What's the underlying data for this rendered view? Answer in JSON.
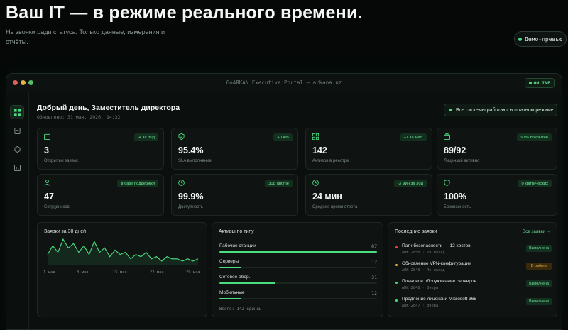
{
  "hero": {
    "title": "Ваш IT — в режиме реального времени.",
    "subtitle": "Не звонки ради статуса. Только данные, измерения и отчёты.",
    "demo_button": "Демо-превью"
  },
  "window": {
    "title": "GoARKAN Executive Portal — arkana.uz",
    "status": "ONLINE"
  },
  "sidebar": {
    "items": [
      {
        "icon": "grid-icon",
        "active": true
      },
      {
        "icon": "document-icon",
        "active": false
      },
      {
        "icon": "hexagon-icon",
        "active": false
      },
      {
        "icon": "chart-icon",
        "active": false
      }
    ]
  },
  "header": {
    "greeting": "Добрый день, Заместитель директора",
    "updated": "Обновлено: 31 мая. 2026, 14:32",
    "system_status": "Все системы работают в штатном режиме"
  },
  "kpis": [
    {
      "icon": "calendar-icon",
      "badge": "-4 за 30д",
      "value": "3",
      "label": "Открытых заявок"
    },
    {
      "icon": "shield-check-icon",
      "badge": "+0.4%",
      "value": "95.4%",
      "label": "SLA выполнение"
    },
    {
      "icon": "grid-icon",
      "badge": "+1 за мес.",
      "value": "142",
      "label": "Активов в реестре"
    },
    {
      "icon": "briefcase-icon",
      "badge": "97% покрытие",
      "value": "89/92",
      "label": "Лицензий активно"
    },
    {
      "icon": "users-icon",
      "badge": "в базе поддержки",
      "value": "47",
      "label": "Сотрудников"
    },
    {
      "icon": "clock-icon",
      "badge": "30д uptime",
      "value": "99.9%",
      "label": "Доступность"
    },
    {
      "icon": "clock-icon",
      "badge": "-3 мин за 30д",
      "value": "24 мин",
      "label": "Среднее время ответа"
    },
    {
      "icon": "shield-icon",
      "badge": "0 критических",
      "value": "100%",
      "label": "Безопасность"
    }
  ],
  "tickets_chart": {
    "title": "Заявки за 30 дней",
    "x_labels": [
      "1 мая",
      "8 мая",
      "15 мая",
      "22 мая",
      "29 мая"
    ]
  },
  "chart_data": {
    "type": "line",
    "x": [
      1,
      2,
      3,
      4,
      5,
      6,
      7,
      8,
      9,
      10,
      11,
      12,
      13,
      14,
      15,
      16,
      17,
      18,
      19,
      20,
      21,
      22,
      23,
      24,
      25,
      26,
      27,
      28,
      29,
      30
    ],
    "values": [
      5,
      9,
      6,
      12,
      8,
      10,
      6,
      9,
      5,
      11,
      6,
      8,
      4,
      7,
      5,
      6,
      3,
      5,
      4,
      6,
      3,
      4,
      2,
      4,
      3,
      3,
      2,
      3,
      2,
      3
    ],
    "x_tick_labels": [
      "1 мая",
      "8 мая",
      "15 мая",
      "22 мая",
      "29 мая"
    ],
    "ylim": [
      0,
      13
    ],
    "grid": false,
    "legend": "none",
    "color": "#4ade80"
  },
  "assets": {
    "title": "Активы по типу",
    "rows": [
      {
        "label": "Рабочие станции",
        "value": 87
      },
      {
        "label": "Серверы",
        "value": 12
      },
      {
        "label": "Сетевое обор.",
        "value": 31
      },
      {
        "label": "Мобильные",
        "value": 12
      }
    ],
    "total": "Всего: 142 единиц"
  },
  "requests": {
    "title": "Последние заявки",
    "all_link": "Все заявки →",
    "items": [
      {
        "title": "Патч безопасности — 12 хостов",
        "meta": "ARK-2850 · 2ч назад",
        "status": "Выполнена",
        "state": "done",
        "dot": "#ef4444"
      },
      {
        "title": "Обновление VPN-конфигурации",
        "meta": "ARK-2849 · 4ч назад",
        "status": "В работе",
        "state": "prog",
        "dot": "#f0b43c"
      },
      {
        "title": "Плановое обслуживание серверов",
        "meta": "ARK-2848 · Вчера",
        "status": "Выполнена",
        "state": "done",
        "dot": "#4ade80"
      },
      {
        "title": "Продление лицензий Microsoft 365",
        "meta": "ARK-2847 · Вчера",
        "status": "Выполнена",
        "state": "done",
        "dot": "#4ade80"
      }
    ]
  },
  "colors": {
    "accent": "#4ade80",
    "warning": "#f0b43c",
    "danger": "#ef4444"
  }
}
